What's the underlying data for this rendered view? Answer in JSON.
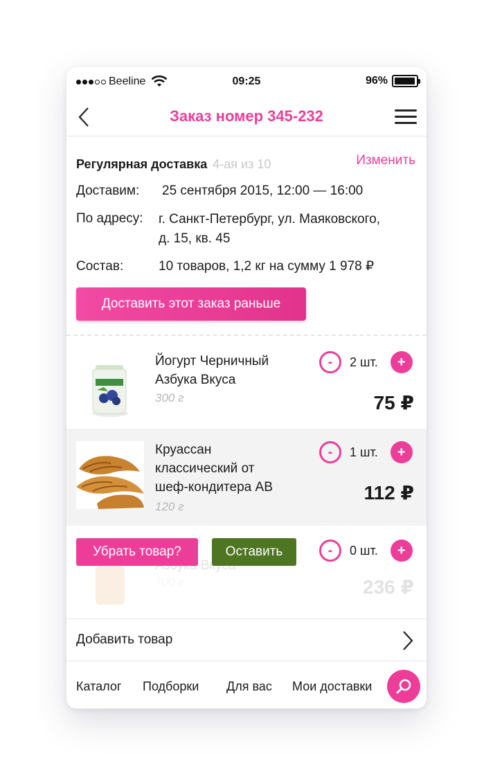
{
  "status_bar": {
    "carrier": "Beeline",
    "time": "09:25",
    "battery": "96%",
    "battery_level": 0.96
  },
  "nav": {
    "title": "Заказ номер 345-232",
    "back_icon": "chevron-left-icon",
    "menu_icon": "hamburger-icon"
  },
  "delivery": {
    "type": "Регулярная доставка",
    "progress": "4-ая из 10",
    "change_label": "Изменить",
    "deliver_label": "Доставим:",
    "deliver_value": "25 сентября 2015, 12:00 — 16:00",
    "address_label": "По адресу:",
    "address_line1": "г. Санкт-Петербург, ул. Маяковского,",
    "address_line2": "д. 15, кв. 45",
    "contents_label": "Состав:",
    "contents_value": "10 товаров, 1,2 кг на сумму 1 978 ₽",
    "cta_label": "Доставить этот заказ раньше"
  },
  "items": [
    {
      "name_line1": "Йогурт Черничный",
      "name_line2": "Азбука Вкуса",
      "weight": "300 г",
      "qty": "2 шт.",
      "price": "75 ₽"
    },
    {
      "name_line1": "Круассан",
      "name_line2": "классический от",
      "name_line3": "шеф-кондитера АВ",
      "weight": "120 г",
      "qty": "1 шт.",
      "price": "112 ₽"
    },
    {
      "name_line2": "Азбука Вкуса",
      "weight": "700 г",
      "qty": "0 шт.",
      "price": "236 ₽"
    }
  ],
  "remove_prompt": {
    "remove_label": "Убрать товар?",
    "keep_label": "Оставить"
  },
  "add_item_label": "Добавить товар",
  "tabs": [
    "Каталог",
    "Подборки",
    "Для вас",
    "Мои доставки"
  ],
  "colors": {
    "accent": "#ec3e99",
    "keep": "#4e7522"
  }
}
